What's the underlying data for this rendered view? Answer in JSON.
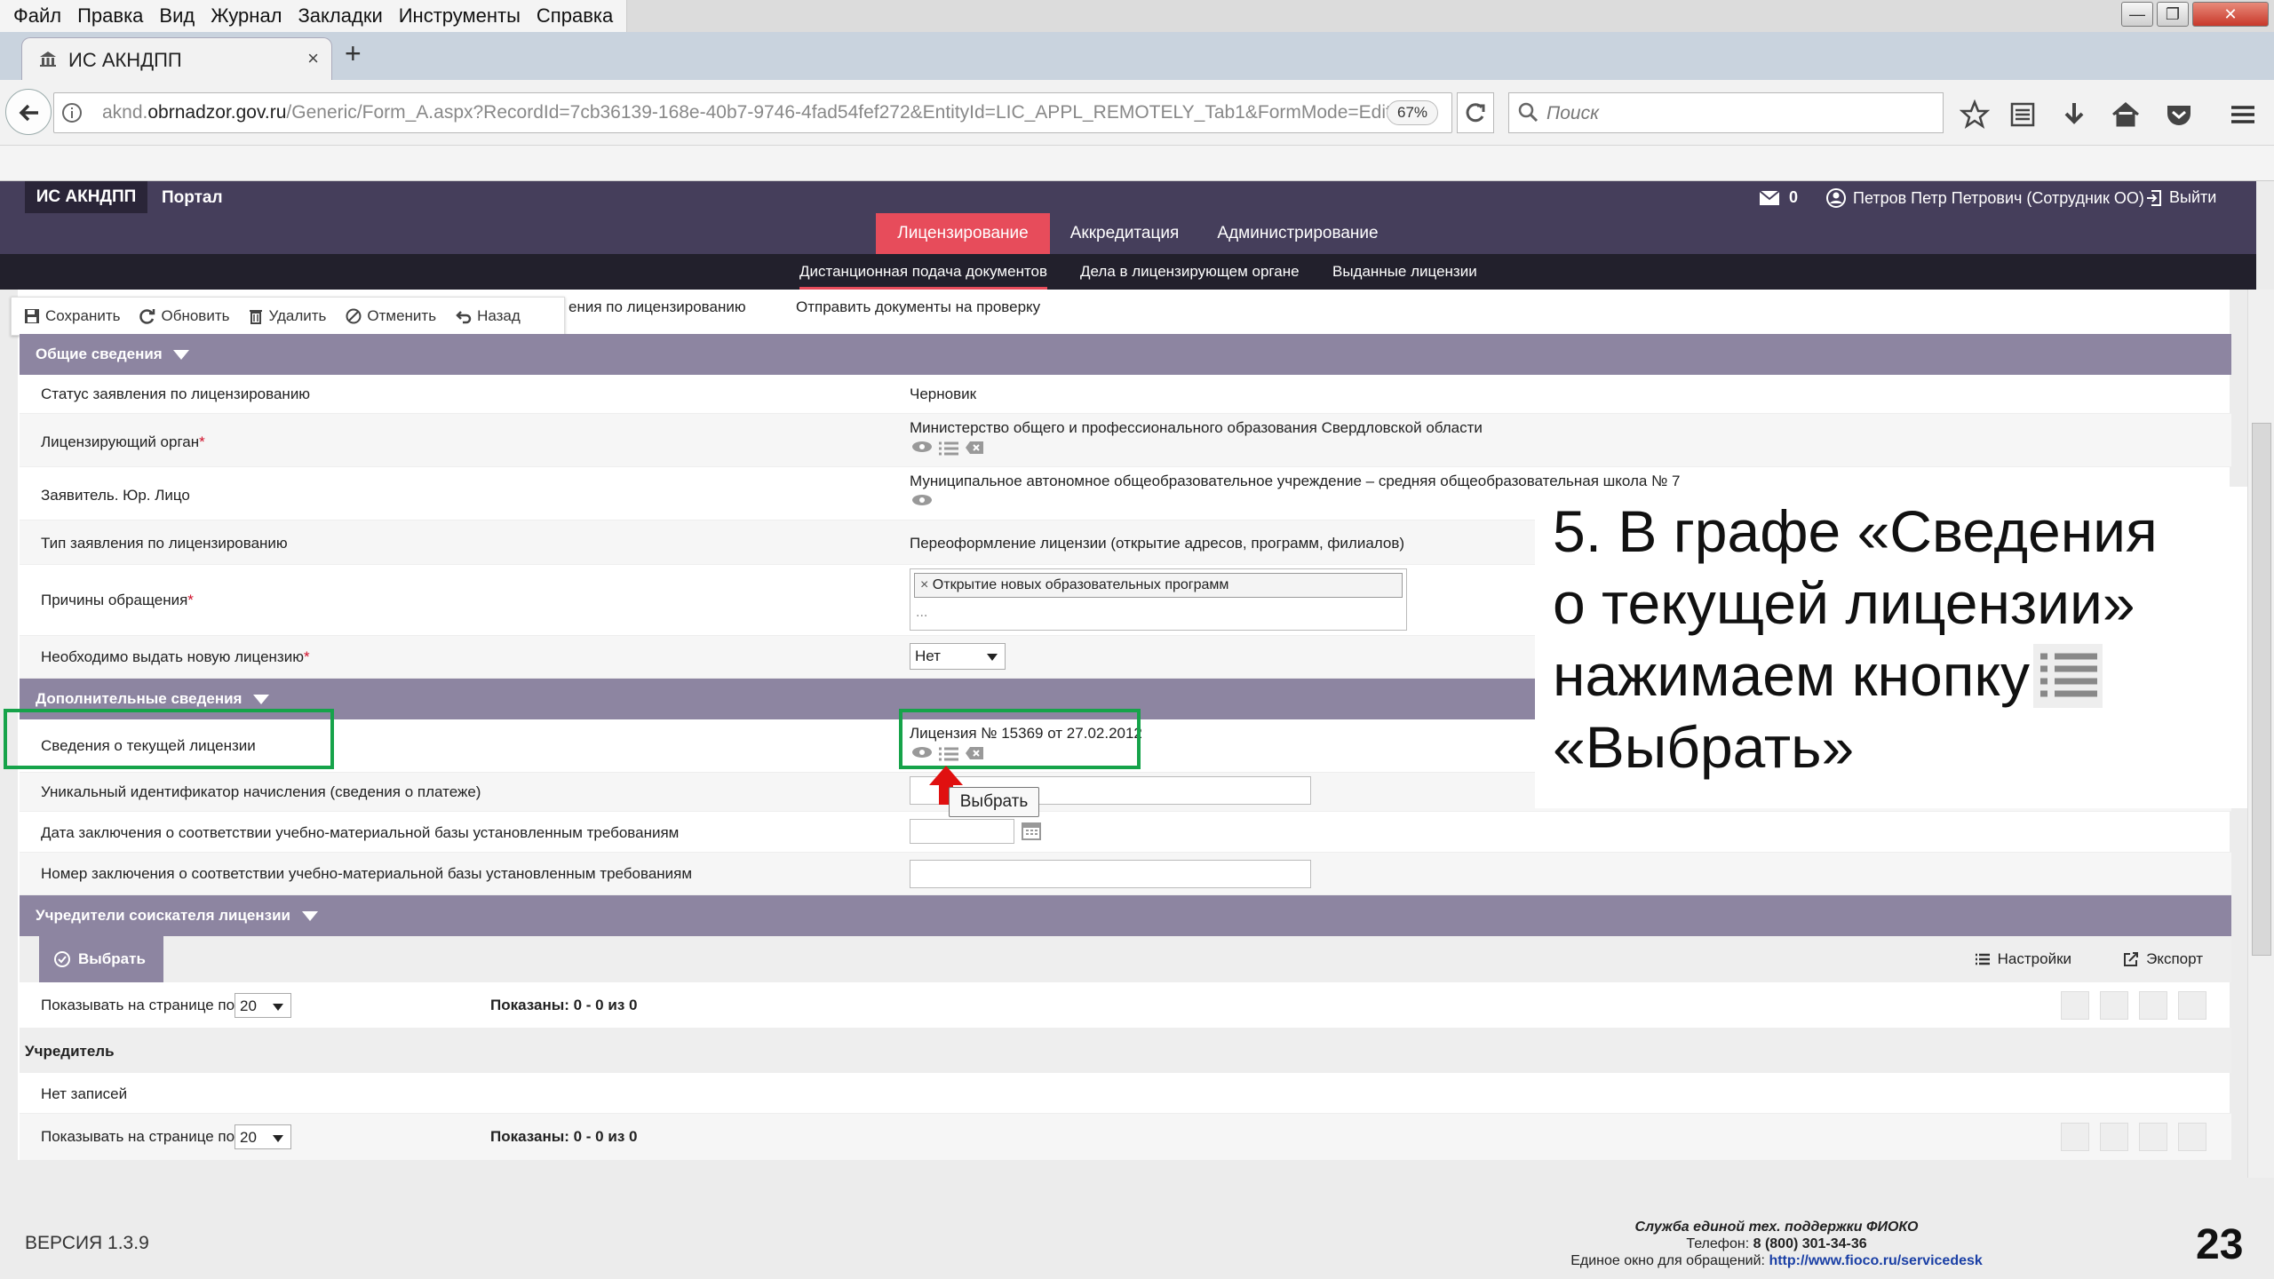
{
  "browser": {
    "menu": [
      "Файл",
      "Правка",
      "Вид",
      "Журнал",
      "Закладки",
      "Инструменты",
      "Справка"
    ],
    "tab_title": "ИС АКНДПП",
    "url_domain": "akndobrnadzor.gov.ru",
    "url_host": "obrnadzor.gov.ru",
    "url_prefix": "aknd.",
    "url_path": "/Generic/Form_A.aspx?RecordId=7cb36139-168e-40b7-9746-4fad54fef272&EntityId=LIC_APPL_REMOTELY_Tab1&FormMode=Edit",
    "zoom": "67%",
    "search_placeholder": "Поиск"
  },
  "app": {
    "logo": "ИС АКНДПП",
    "portal": "Портал",
    "messages_count": "0",
    "user": "Петров Петр Петрович (Сотрудник ОО)",
    "logout": "Выйти",
    "main_tabs": [
      "Лицензирование",
      "Аккредитация",
      "Администрирование"
    ],
    "sub_tabs": [
      "Дистанционная подача документов",
      "Дела в лицензирующем органе",
      "Выданные лицензии"
    ]
  },
  "toolbar": {
    "save": "Сохранить",
    "refresh": "Обновить",
    "delete": "Удалить",
    "cancel": "Отменить",
    "back": "Назад",
    "link_partial": "ения по лицензированию",
    "send_docs": "Отправить документы на проверку"
  },
  "sections": {
    "general": "Общие сведения",
    "additional": "Дополнительные сведения",
    "founders": "Учредители соискателя лицензии"
  },
  "fields": {
    "status_label": "Статус заявления по лицензированию",
    "status_value": "Черновик",
    "organ_label": "Лицензирующий орган",
    "organ_value": "Министерство общего и профессионального образования Свердловской области",
    "applicant_label": "Заявитель. Юр. Лицо",
    "applicant_value": "Муниципальное автономное общеобразовательное учреждение – средняя общеобразовательная школа № 7",
    "type_label": "Тип заявления по лицензированию",
    "type_value": "Переоформление лицензии (открытие адресов, программ, филиалов)",
    "reasons_label": "Причины обращения",
    "reasons_tag": "Открытие новых образовательных программ",
    "reasons_more": "...",
    "new_license_label": "Необходимо выдать новую лицензию",
    "new_license_value": "Нет",
    "current_license_label": "Сведения о текущей лицензии",
    "current_license_value": "Лицензия № 15369 от 27.02.2012",
    "uid_label": "Уникальный идентификатор начисления (сведения о платеже)",
    "conclusion_date_label": "Дата заключения о соответствии учебно-материальной базы установленным требованиям",
    "conclusion_number_label": "Номер заключения о соответствии учебно-материальной базы установленным требованиям",
    "tooltip": "Выбрать"
  },
  "founders": {
    "choose": "Выбрать",
    "settings": "Настройки",
    "export": "Экспорт",
    "per_page_label": "Показывать на странице по",
    "per_page": "20",
    "shown": "Показаны: 0 - 0 из 0",
    "column": "Учредитель",
    "empty": "Нет записей"
  },
  "overlay": {
    "line1": "5. В графе «Сведения",
    "line2": "о текущей лицензии»",
    "line3": "нажимаем кнопку",
    "line4": "«Выбрать»"
  },
  "footer": {
    "version": "ВЕРСИЯ 1.3.9",
    "support_title": "Служба единой тех. поддержки ФИОКО",
    "phone_label": "Телефон:",
    "phone": "8 (800) 301-34-36",
    "window_label": "Единое окно для обращений:",
    "link": "http://www.fioco.ru/servicedesk",
    "page_number": "23"
  },
  "colors": {
    "header": "#453e5b",
    "accent": "#e74c5b",
    "section": "#8d85a1",
    "highlight": "#16a34a",
    "arrow": "#e01010"
  }
}
